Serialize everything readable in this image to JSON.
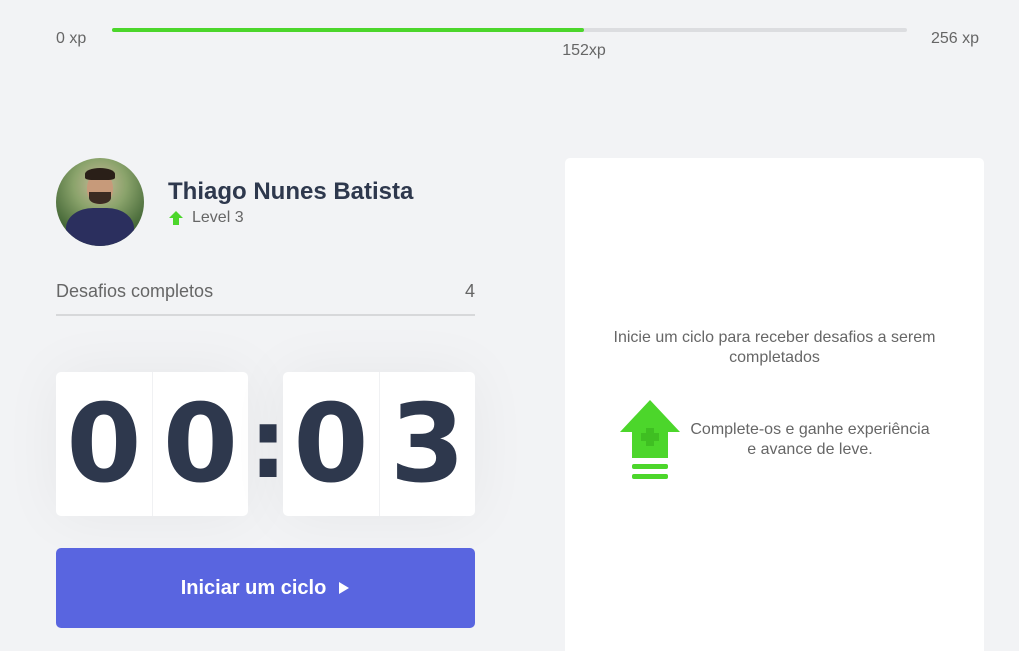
{
  "xp": {
    "min_label": "0 xp",
    "max_label": "256 xp",
    "current_label": "152xp",
    "current": 152,
    "max": 256,
    "bar_color": "#4cd62b"
  },
  "profile": {
    "avatar_icon": "avatar-photo",
    "name": "Thiago Nunes Batista",
    "level_icon": "level-up-arrow-icon",
    "level_label": "Level 3"
  },
  "challenges": {
    "label": "Desafios completos",
    "value": "4"
  },
  "countdown": {
    "minutes": [
      "0",
      "0"
    ],
    "separator": ":",
    "seconds": [
      "0",
      "3"
    ]
  },
  "start_button": {
    "label": "Iniciar um ciclo",
    "icon": "play-icon",
    "color": "#5965e0"
  },
  "challenge_box": {
    "intro": "Inicie um ciclo para receber desafios a serem completados",
    "icon": "level-up-icon",
    "hint": "Complete-os e ganhe experiência e avance de leve."
  },
  "colors": {
    "background": "#f2f3f5",
    "title": "#2e384d",
    "text": "#666666",
    "green": "#4cd62b"
  }
}
